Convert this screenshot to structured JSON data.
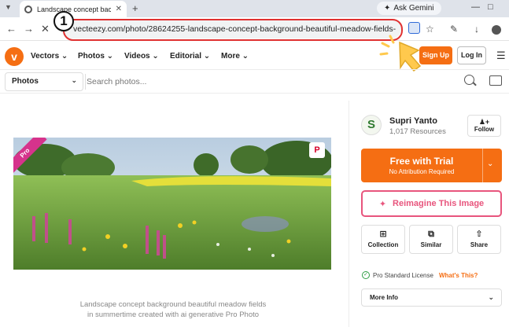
{
  "browser": {
    "tab_title": "Landscape concept backgrou",
    "ask_gemini": "Ask Gemini",
    "url": "vecteezy.com/photo/28624255-landscape-concept-background-beautiful-meadow-fields-in-summerti",
    "step_badge": "1"
  },
  "site": {
    "logo_letter": "v",
    "menu": [
      "Vectors",
      "Photos",
      "Videos",
      "Editorial",
      "More"
    ],
    "sign_up": "Sign Up",
    "log_in": "Log In"
  },
  "search": {
    "category": "Photos",
    "placeholder": "Search photos..."
  },
  "image": {
    "badge": "Pro",
    "pin_label": "P",
    "caption_line1": "Landscape concept background beautiful meadow fields",
    "caption_line2": "in summertime created with ai generative Pro Photo"
  },
  "author": {
    "initial": "S",
    "name": "Supri Yanto",
    "resources": "1,017 Resources",
    "follow": "Follow"
  },
  "cta": {
    "trial_title": "Free with Trial",
    "trial_sub": "No Attribution Required",
    "reimagine": "Reimagine This Image"
  },
  "actions": [
    {
      "label": "Collection",
      "icon": "collection-icon"
    },
    {
      "label": "Similar",
      "icon": "similar-icon"
    },
    {
      "label": "Share",
      "icon": "share-icon"
    }
  ],
  "license": {
    "text": "Pro Standard License",
    "link": "What's This?"
  },
  "more_info": "More Info",
  "colors": {
    "brand_orange": "#f56e13",
    "reimagine_pink": "#e8557d",
    "pro_pink": "#d6338c",
    "annotation_red": "#e03131",
    "annotation_cursor": "#ffc94d"
  }
}
